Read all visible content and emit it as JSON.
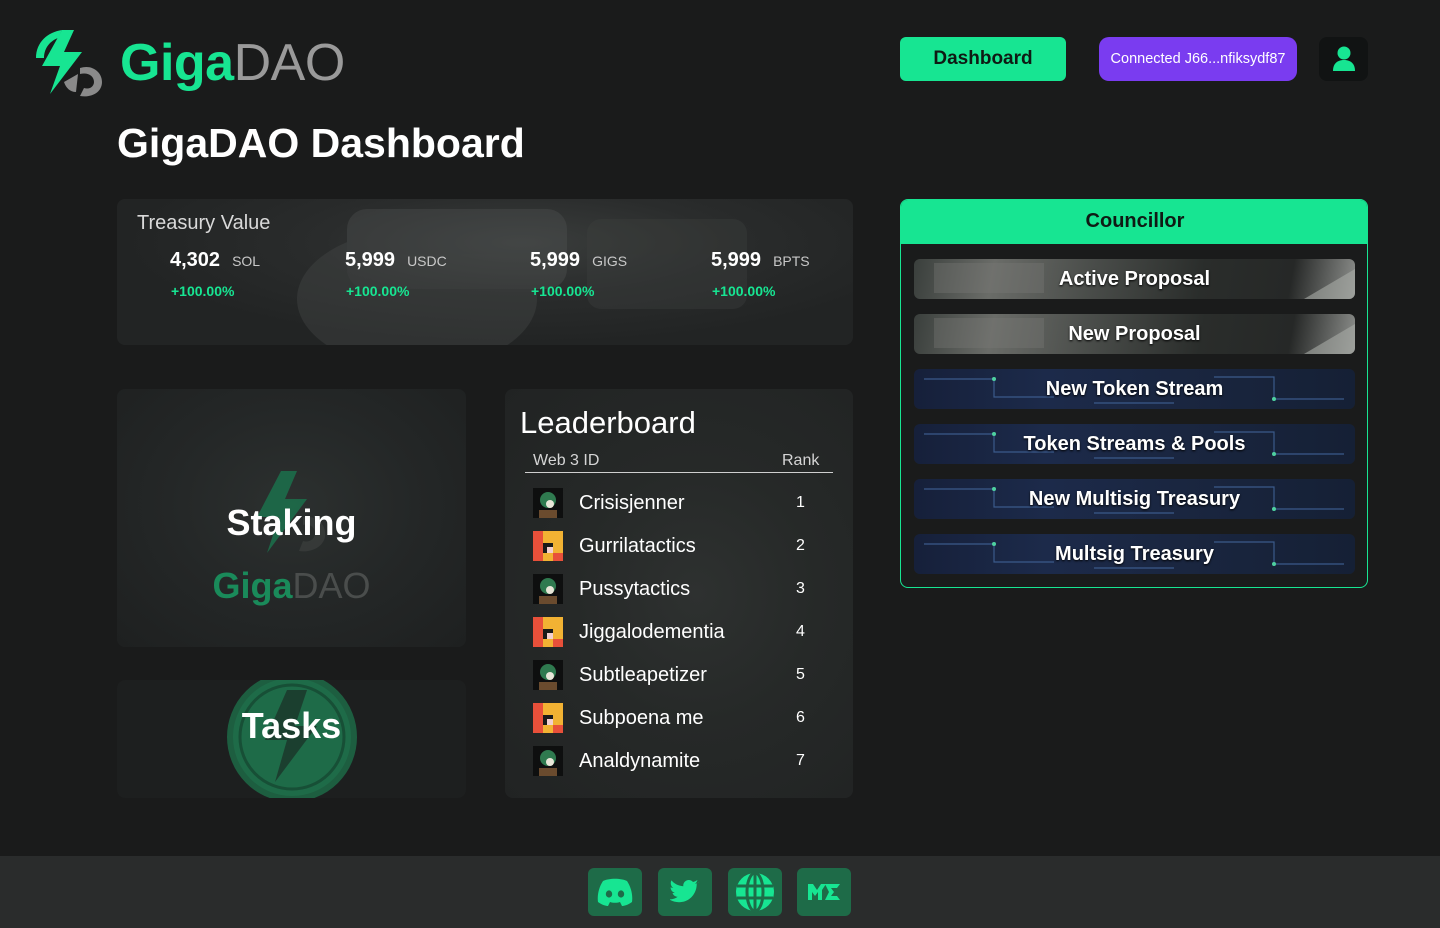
{
  "brand": {
    "logo_primary": "Giga",
    "logo_secondary": "DAO",
    "accent": "#17e592"
  },
  "header": {
    "dashboard_label": "Dashboard",
    "wallet_label": "Connected J66...nfiksydf87",
    "wallet_color": "#7a3cf0",
    "profile_icon": "user-icon"
  },
  "page": {
    "title": "GigaDAO Dashboard"
  },
  "treasury": {
    "label": "Treasury Value",
    "assets": [
      {
        "amount": "4,302",
        "symbol": "SOL",
        "change": "+100.00%"
      },
      {
        "amount": "5,999",
        "symbol": "USDC",
        "change": "+100.00%"
      },
      {
        "amount": "5,999",
        "symbol": "GIGS",
        "change": "+100.00%"
      },
      {
        "amount": "5,999",
        "symbol": "BPTS",
        "change": "+100.00%"
      }
    ]
  },
  "staking": {
    "title": "Staking",
    "brand_primary": "Giga",
    "brand_secondary": "DAO"
  },
  "tasks": {
    "title": "Tasks"
  },
  "leaderboard": {
    "title": "Leaderboard",
    "col_id": "Web 3 ID",
    "col_rank": "Rank",
    "rows": [
      {
        "name": "Crisisjenner",
        "rank": "1",
        "avatar": "green-character-avatar"
      },
      {
        "name": "Gurrilatactics",
        "rank": "2",
        "avatar": "pixel-block-avatar"
      },
      {
        "name": "Pussytactics",
        "rank": "3",
        "avatar": "green-character-avatar"
      },
      {
        "name": "Jiggalodementia",
        "rank": "4",
        "avatar": "pixel-block-avatar"
      },
      {
        "name": "Subtleapetizer",
        "rank": "5",
        "avatar": "green-character-avatar"
      },
      {
        "name": "Subpoena me",
        "rank": "6",
        "avatar": "pixel-block-avatar"
      },
      {
        "name": "Analdynamite",
        "rank": "7",
        "avatar": "green-character-avatar"
      }
    ]
  },
  "councillor": {
    "title": "Councillor",
    "items": [
      {
        "label": "Active Proposal"
      },
      {
        "label": "New Proposal"
      },
      {
        "label": "New Token Stream"
      },
      {
        "label": "Token Streams & Pools"
      },
      {
        "label": "New Multisig Treasury"
      },
      {
        "label": "Multsig Treasury"
      }
    ]
  },
  "footer": {
    "links": [
      "discord-icon",
      "twitter-icon",
      "globe-icon",
      "magic-eden-icon"
    ]
  }
}
